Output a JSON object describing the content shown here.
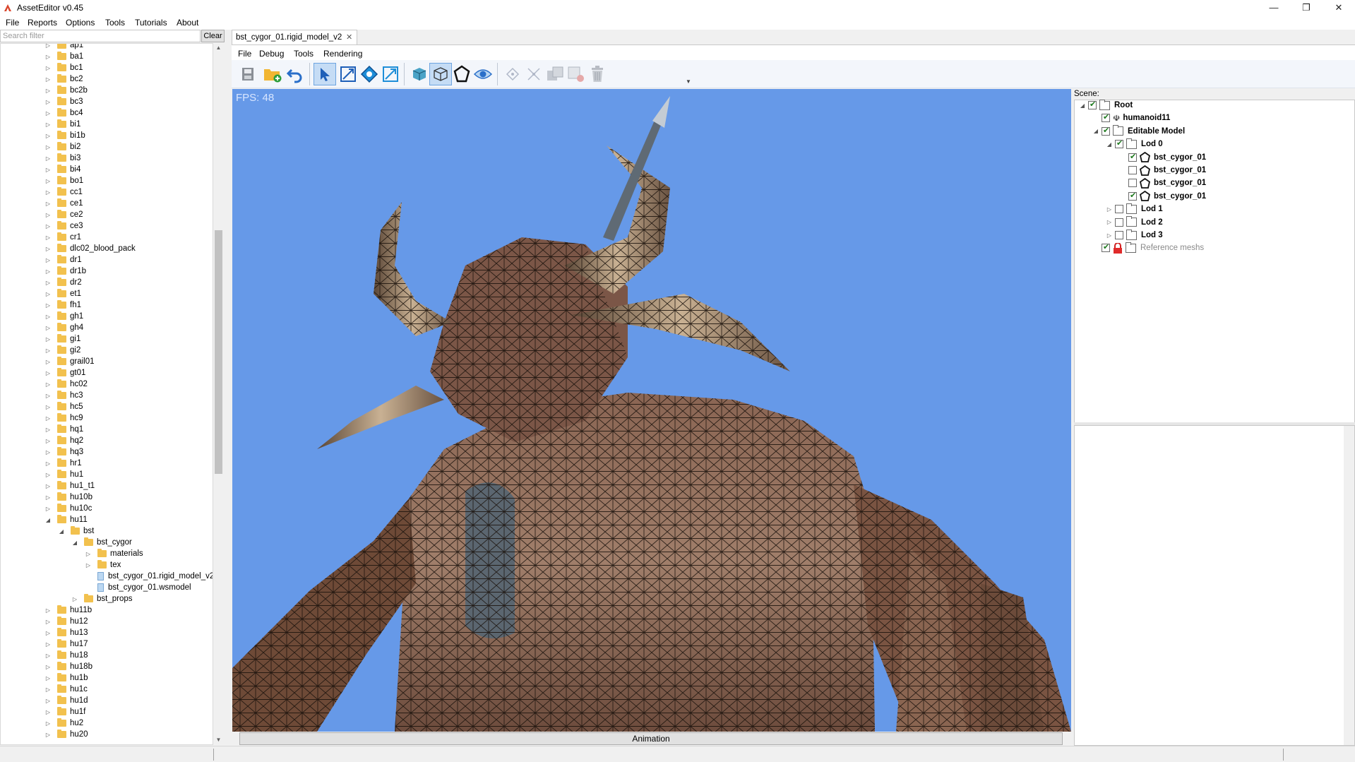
{
  "window": {
    "title": "AssetEditor v0.45",
    "minimize": "—",
    "maximize": "❐",
    "close": "✕"
  },
  "menubar": [
    "File",
    "Reports",
    "Options",
    "Tools",
    "Tutorials",
    "About"
  ],
  "left_panel": {
    "search_placeholder": "Search filter",
    "clear_label": "Clear",
    "tree": [
      {
        "label": "ap1",
        "type": "folder",
        "depth": 0,
        "state": "collapsed"
      },
      {
        "label": "ba1",
        "type": "folder",
        "depth": 0,
        "state": "collapsed"
      },
      {
        "label": "bc1",
        "type": "folder",
        "depth": 0,
        "state": "collapsed"
      },
      {
        "label": "bc2",
        "type": "folder",
        "depth": 0,
        "state": "collapsed"
      },
      {
        "label": "bc2b",
        "type": "folder",
        "depth": 0,
        "state": "collapsed"
      },
      {
        "label": "bc3",
        "type": "folder",
        "depth": 0,
        "state": "collapsed"
      },
      {
        "label": "bc4",
        "type": "folder",
        "depth": 0,
        "state": "collapsed"
      },
      {
        "label": "bi1",
        "type": "folder",
        "depth": 0,
        "state": "collapsed"
      },
      {
        "label": "bi1b",
        "type": "folder",
        "depth": 0,
        "state": "collapsed"
      },
      {
        "label": "bi2",
        "type": "folder",
        "depth": 0,
        "state": "collapsed"
      },
      {
        "label": "bi3",
        "type": "folder",
        "depth": 0,
        "state": "collapsed"
      },
      {
        "label": "bi4",
        "type": "folder",
        "depth": 0,
        "state": "collapsed"
      },
      {
        "label": "bo1",
        "type": "folder",
        "depth": 0,
        "state": "collapsed"
      },
      {
        "label": "cc1",
        "type": "folder",
        "depth": 0,
        "state": "collapsed"
      },
      {
        "label": "ce1",
        "type": "folder",
        "depth": 0,
        "state": "collapsed"
      },
      {
        "label": "ce2",
        "type": "folder",
        "depth": 0,
        "state": "collapsed"
      },
      {
        "label": "ce3",
        "type": "folder",
        "depth": 0,
        "state": "collapsed"
      },
      {
        "label": "cr1",
        "type": "folder",
        "depth": 0,
        "state": "collapsed"
      },
      {
        "label": "dlc02_blood_pack",
        "type": "folder",
        "depth": 0,
        "state": "collapsed"
      },
      {
        "label": "dr1",
        "type": "folder",
        "depth": 0,
        "state": "collapsed"
      },
      {
        "label": "dr1b",
        "type": "folder",
        "depth": 0,
        "state": "collapsed"
      },
      {
        "label": "dr2",
        "type": "folder",
        "depth": 0,
        "state": "collapsed"
      },
      {
        "label": "et1",
        "type": "folder",
        "depth": 0,
        "state": "collapsed"
      },
      {
        "label": "fh1",
        "type": "folder",
        "depth": 0,
        "state": "collapsed"
      },
      {
        "label": "gh1",
        "type": "folder",
        "depth": 0,
        "state": "collapsed"
      },
      {
        "label": "gh4",
        "type": "folder",
        "depth": 0,
        "state": "collapsed"
      },
      {
        "label": "gi1",
        "type": "folder",
        "depth": 0,
        "state": "collapsed"
      },
      {
        "label": "gi2",
        "type": "folder",
        "depth": 0,
        "state": "collapsed"
      },
      {
        "label": "grail01",
        "type": "folder",
        "depth": 0,
        "state": "collapsed"
      },
      {
        "label": "gt01",
        "type": "folder",
        "depth": 0,
        "state": "collapsed"
      },
      {
        "label": "hc02",
        "type": "folder",
        "depth": 0,
        "state": "collapsed"
      },
      {
        "label": "hc3",
        "type": "folder",
        "depth": 0,
        "state": "collapsed"
      },
      {
        "label": "hc5",
        "type": "folder",
        "depth": 0,
        "state": "collapsed"
      },
      {
        "label": "hc9",
        "type": "folder",
        "depth": 0,
        "state": "collapsed"
      },
      {
        "label": "hq1",
        "type": "folder",
        "depth": 0,
        "state": "collapsed"
      },
      {
        "label": "hq2",
        "type": "folder",
        "depth": 0,
        "state": "collapsed"
      },
      {
        "label": "hq3",
        "type": "folder",
        "depth": 0,
        "state": "collapsed"
      },
      {
        "label": "hr1",
        "type": "folder",
        "depth": 0,
        "state": "collapsed"
      },
      {
        "label": "hu1",
        "type": "folder",
        "depth": 0,
        "state": "collapsed"
      },
      {
        "label": "hu1_t1",
        "type": "folder",
        "depth": 0,
        "state": "collapsed"
      },
      {
        "label": "hu10b",
        "type": "folder",
        "depth": 0,
        "state": "collapsed"
      },
      {
        "label": "hu10c",
        "type": "folder",
        "depth": 0,
        "state": "collapsed"
      },
      {
        "label": "hu11",
        "type": "folder",
        "depth": 0,
        "state": "expanded"
      },
      {
        "label": "bst",
        "type": "folder",
        "depth": 1,
        "state": "expanded"
      },
      {
        "label": "bst_cygor",
        "type": "folder",
        "depth": 2,
        "state": "expanded"
      },
      {
        "label": "materials",
        "type": "folder",
        "depth": 3,
        "state": "collapsed"
      },
      {
        "label": "tex",
        "type": "folder",
        "depth": 3,
        "state": "collapsed"
      },
      {
        "label": "bst_cygor_01.rigid_model_v2",
        "type": "file",
        "depth": 3,
        "state": "none"
      },
      {
        "label": "bst_cygor_01.wsmodel",
        "type": "file",
        "depth": 3,
        "state": "none"
      },
      {
        "label": "bst_props",
        "type": "folder",
        "depth": 2,
        "state": "collapsed"
      },
      {
        "label": "hu11b",
        "type": "folder",
        "depth": 0,
        "state": "collapsed"
      },
      {
        "label": "hu12",
        "type": "folder",
        "depth": 0,
        "state": "collapsed"
      },
      {
        "label": "hu13",
        "type": "folder",
        "depth": 0,
        "state": "collapsed"
      },
      {
        "label": "hu17",
        "type": "folder",
        "depth": 0,
        "state": "collapsed"
      },
      {
        "label": "hu18",
        "type": "folder",
        "depth": 0,
        "state": "collapsed"
      },
      {
        "label": "hu18b",
        "type": "folder",
        "depth": 0,
        "state": "collapsed"
      },
      {
        "label": "hu1b",
        "type": "folder",
        "depth": 0,
        "state": "collapsed"
      },
      {
        "label": "hu1c",
        "type": "folder",
        "depth": 0,
        "state": "collapsed"
      },
      {
        "label": "hu1d",
        "type": "folder",
        "depth": 0,
        "state": "collapsed"
      },
      {
        "label": "hu1f",
        "type": "folder",
        "depth": 0,
        "state": "collapsed"
      },
      {
        "label": "hu2",
        "type": "folder",
        "depth": 0,
        "state": "collapsed"
      },
      {
        "label": "hu20",
        "type": "folder",
        "depth": 0,
        "state": "collapsed"
      }
    ]
  },
  "document": {
    "tab_label": "bst_cygor_01.rigid_model_v2",
    "tab_close": "✕",
    "menu": [
      "File",
      "Debug",
      "Tools",
      "Rendering"
    ],
    "toolbar_icons": [
      "save-icon",
      "add-folder-icon",
      "undo-icon",
      "select-icon",
      "scale-icon",
      "rotate-icon",
      "expand-icon",
      "cube-icon",
      "wireframe-cube-icon",
      "polygon-icon",
      "eye-icon",
      "vertex-icon",
      "split-icon",
      "duplicate-icon",
      "merge-icon",
      "delete-icon"
    ],
    "fps_text": "FPS: 48",
    "animation_button": "Animation",
    "viewport_bg": "#6699e8"
  },
  "scene": {
    "label": "Scene:",
    "items": [
      {
        "label": "Root",
        "bold": true,
        "checked": true,
        "expander": "expanded",
        "icon": "folder",
        "depth": 0
      },
      {
        "label": "humanoid11",
        "bold": true,
        "checked": true,
        "expander": "none",
        "icon": "skeleton",
        "depth": 1
      },
      {
        "label": "Editable Model",
        "bold": true,
        "checked": true,
        "expander": "expanded",
        "icon": "folder",
        "depth": 1
      },
      {
        "label": "Lod 0",
        "bold": true,
        "checked": true,
        "expander": "expanded",
        "icon": "folder",
        "depth": 2
      },
      {
        "label": "bst_cygor_01",
        "bold": true,
        "checked": true,
        "expander": "none",
        "icon": "mesh",
        "depth": 3
      },
      {
        "label": "bst_cygor_01",
        "bold": true,
        "checked": false,
        "expander": "none",
        "icon": "mesh",
        "depth": 3
      },
      {
        "label": "bst_cygor_01",
        "bold": true,
        "checked": false,
        "expander": "none",
        "icon": "mesh",
        "depth": 3
      },
      {
        "label": "bst_cygor_01",
        "bold": true,
        "checked": true,
        "expander": "none",
        "icon": "mesh",
        "depth": 3
      },
      {
        "label": "Lod 1",
        "bold": true,
        "checked": false,
        "expander": "collapsed",
        "icon": "folder",
        "depth": 2
      },
      {
        "label": "Lod 2",
        "bold": true,
        "checked": false,
        "expander": "collapsed",
        "icon": "folder",
        "depth": 2
      },
      {
        "label": "Lod 3",
        "bold": true,
        "checked": false,
        "expander": "collapsed",
        "icon": "folder",
        "depth": 2
      },
      {
        "label": "Reference meshs",
        "bold": false,
        "checked": true,
        "expander": "none",
        "icon": "lock-folder",
        "depth": 1
      }
    ]
  }
}
